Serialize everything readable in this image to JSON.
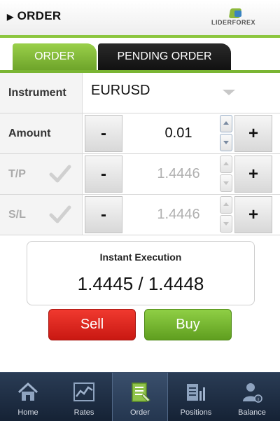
{
  "header": {
    "title": "ORDER",
    "logo_text": "LIDERFOREX"
  },
  "tabs": [
    {
      "label": "ORDER",
      "active": true
    },
    {
      "label": "PENDING ORDER",
      "active": false
    }
  ],
  "form": {
    "instrument": {
      "label": "Instrument",
      "value": "EURUSD"
    },
    "amount": {
      "label": "Amount",
      "value": "0.01"
    },
    "tp": {
      "label": "T/P",
      "value": "1.4446"
    },
    "sl": {
      "label": "S/L",
      "value": "1.4446"
    },
    "minus_label": "-",
    "plus_label": "+"
  },
  "execution": {
    "title": "Instant Execution",
    "price": "1.4445 / 1.4448"
  },
  "actions": {
    "sell_label": "Sell",
    "buy_label": "Buy"
  },
  "nav": [
    {
      "label": "Home",
      "icon": "home-icon"
    },
    {
      "label": "Rates",
      "icon": "chart-icon"
    },
    {
      "label": "Order",
      "icon": "order-icon",
      "active": true
    },
    {
      "label": "Positions",
      "icon": "positions-icon"
    },
    {
      "label": "Balance",
      "icon": "balance-icon"
    }
  ],
  "colors": {
    "accent_green": "#8cc63f",
    "sell_red": "#e02a22",
    "buy_green": "#78b935",
    "nav_bg": "#1d2d44"
  }
}
